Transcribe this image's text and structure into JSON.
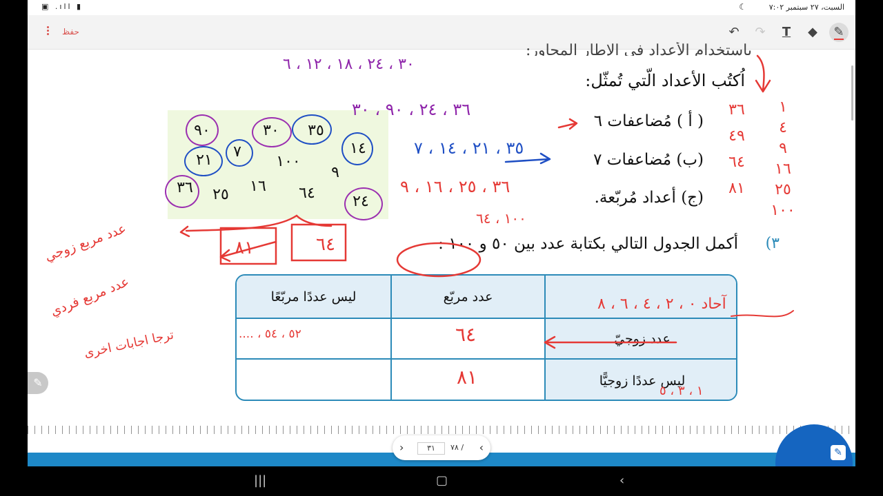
{
  "status_bar": {
    "time": "السبت، ٢٧ سبتمبر  ٧:٠٢",
    "icons": "▮ ıll. ▣"
  },
  "toolbar": {
    "save_label": "حفظ"
  },
  "worksheet": {
    "instruction_cut": "باستخدام الأعداد في الإطار المجاور:",
    "instruction": "اُكتُب الأعداد الّتي تُمثّل:",
    "item_a": "( أ ) مُضاعفات ٦",
    "item_b": "(ب) مُضاعفات ٧",
    "item_c": "(ج) أعداد مُربّعة.",
    "q3_number": "٣)",
    "q3_text": "أكمل الجدول التالي بكتابة عدد بين ٥٠ و ١٠٠ :",
    "numbers": [
      "٩٠",
      "٣٠",
      "٣٥",
      "٢١",
      "٧",
      "١٤",
      "١٠٠",
      "٩",
      "٣٦",
      "٢٥",
      "١٦",
      "٦٤",
      "٢٤"
    ],
    "table": {
      "header_square": "عدد مربّع",
      "header_not_square": "ليس عددًا مربّعًا",
      "row_even": "عدد زوجيّ",
      "row_not_even": "ليس عددًا زوجيًّا"
    }
  },
  "handwriting": {
    "answer_a": "٣٦ ، ٢٤ ، ٩٠ ، ٣٠",
    "answer_b": "٣٥ ، ٢١ ، ١٤ ، ٧",
    "answer_c": "٣٦ ، ٢٥ ، ١٦ ، ٩",
    "answer_c_2": "١٠٠ ، ٦٤",
    "top_line": "٣٠ ، ٢٤ ، ١٨ ، ١٢ ، ٦",
    "squares_list": [
      "١",
      "٤",
      "٩",
      "١٦",
      "٢٥",
      "١٠٠"
    ],
    "squares_list_2": [
      "٣٦",
      "٤٩",
      "٦٤",
      "٨١"
    ],
    "box_1": "٨١",
    "box_2": "٦٤",
    "note_even_square": "عدد مربع زوجي",
    "note_odd_square": "عدد مربع فردي",
    "note_other": "ترجا اجابات اخرى",
    "cell_even_square": "٦٤",
    "cell_odd_square": "٨١",
    "cell_even_not_square": "٥٢ ، ٥٤ ، ....",
    "units": "آحاد ٠ ، ٢ ، ٤ ، ٦ ، ٨",
    "odd_digits": "١ ، ٣ ، ٥"
  },
  "pager": {
    "current": "٣١",
    "total": "٧٨ /"
  },
  "colors": {
    "ink_red": "#e53935",
    "ink_blue": "#1f4fc4",
    "ink_purple": "#9b2fb0",
    "table_border": "#2b8ab8",
    "band": "#1e88c7"
  }
}
